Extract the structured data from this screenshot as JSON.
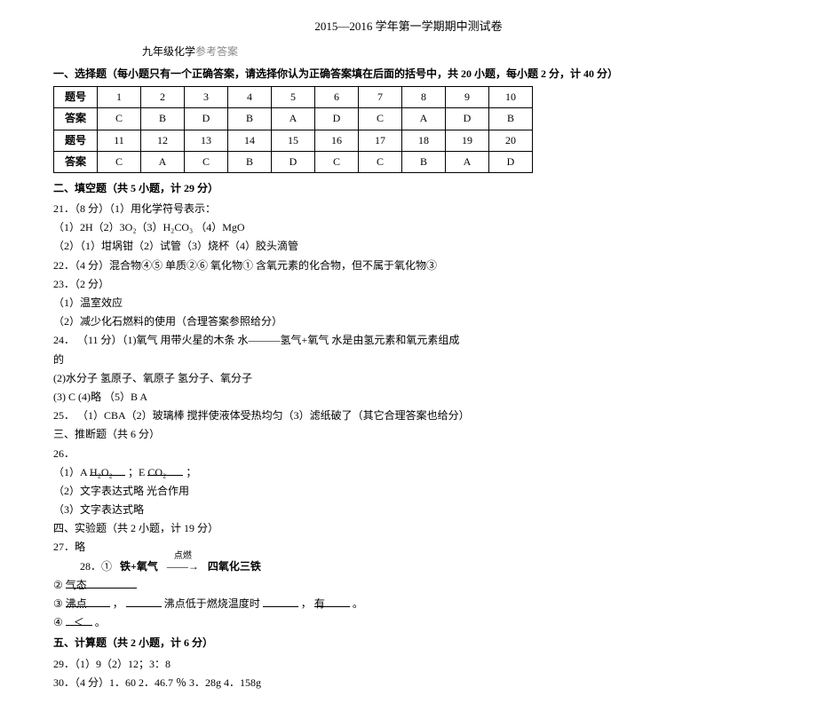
{
  "title": "2015—2016 学年第一学期期中测试卷",
  "subject_line_before": "九年级化学",
  "subject_line_gray": "参考答案",
  "section1_head": "一、选择题（每小题只有一个正确答案，请选择你认为正确答案填在后面的括号中，共 20 小题，每小题 2 分，计 40 分）",
  "table": {
    "row_label_num": "题号",
    "row_label_ans": "答案",
    "nums1": [
      "1",
      "2",
      "3",
      "4",
      "5",
      "6",
      "7",
      "8",
      "9",
      "10"
    ],
    "ans1": [
      "C",
      "B",
      "D",
      "B",
      "A",
      "D",
      "C",
      "A",
      "D",
      "B"
    ],
    "nums2": [
      "11",
      "12",
      "13",
      "14",
      "15",
      "16",
      "17",
      "18",
      "19",
      "20"
    ],
    "ans2": [
      "C",
      "A",
      "C",
      "B",
      "D",
      "C",
      "C",
      "B",
      "A",
      "D"
    ]
  },
  "section2_head": "二、填空题（共 5 小题，计 29 分）",
  "q21_head": "21．（8 分）（1）用化学符号表示：",
  "q21_sub1": "（1）2H（2）3O₂（3）H₂CO₃    （4）MgO",
  "q21_sub2": "（2）（1）坩埚钳（2）试管（3）烧杯（4）胶头滴管",
  "q22": "22．（4 分）混合物④⑤    单质②⑥    氧化物①    含氧元素的化合物，但不属于氧化物③",
  "q23_head": "23．（2 分）",
  "q23_sub1": "（1）温室效应",
  "q23_sub2": "（2）减少化石燃料的使用（合理答案参照给分）",
  "q24_head": "24． （11 分）（1)氧气    用带火星的木条    水———氢气+氧气  水是由氢元素和氧元素组成",
  "q24_tail": "的",
  "q24_sub2": "(2)水分子    氢原子、氧原子    氢分子、氧分子",
  "q24_sub3": "(3) C    (4)略    （5）B  A",
  "q25": "25． （1）CBA（2）玻璃棒    搅拌使液体受热均匀（3）滤纸破了（其它合理答案也给分）",
  "section3_head": "三、推断题（共 6 分）",
  "q26_head": "26．",
  "q26_sub1_a": "（1）A",
  "q26_sub1_h2o": "   H₂O₂   ",
  "q26_sub1_mid": "；E",
  "q26_sub1_co2": "   CO₂   ",
  "q26_sub1_end": "；",
  "q26_sub2": "（2）文字表达式略    光合作用",
  "q26_sub3": "（3）文字表达式略",
  "section4_head": "四、实验题（共 2 小题，计 19 分）",
  "q27": "27．略",
  "q28_head": "28．①    铁+氧气 ——→ 四氧化三铁",
  "q28_anno": "点燃",
  "q28_sub2_pre": "②",
  "q28_sub2_val": "     气态     ",
  "q28_sub3_a": "③",
  "q28_sub3_b": "   沸点   ",
  "q28_sub3_c": "，",
  "q28_sub3_d": "            ",
  "q28_sub3_e": "沸点低于燃烧温度时",
  "q28_sub3_f": "          ",
  "q28_sub3_g": "，",
  "q28_sub3_h": "    有    ",
  "q28_sub3_i": "。",
  "q28_sub4_a": "④",
  "q28_sub4_b": "  ＜  ",
  "q28_sub4_c": "。",
  "section5_head": "五、计算题（共 2 小题，计 6 分）",
  "q29": "29．（1）9（2）12；3：8",
  "q30": "30．（4 分）1．60     2．46.7 ％     3．28g     4．158g"
}
